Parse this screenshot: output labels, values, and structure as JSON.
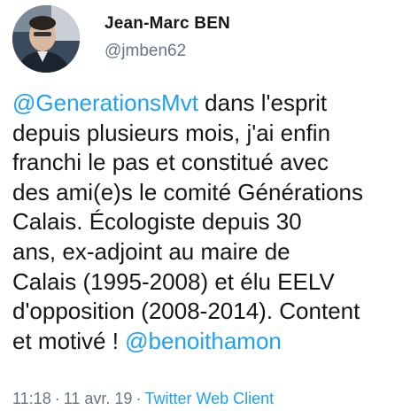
{
  "author": {
    "name": "Jean-Marc BEN",
    "handle": "@jmben62"
  },
  "tweet": {
    "lines": [
      {
        "mention": "@GenerationsMvt",
        "text": " dans l'esprit"
      },
      {
        "text": "depuis plusieurs mois, j'ai enfin"
      },
      {
        "text": "franchi le pas et constitué avec"
      },
      {
        "text": "des ami(e)s le comité Générations"
      },
      {
        "text": "Calais. Écologiste depuis 30"
      },
      {
        "text": "ans, ex-adjoint au maire de"
      },
      {
        "text": "Calais (1995-2008) et élu EELV"
      },
      {
        "text": "d'opposition (2008-2014). Content"
      },
      {
        "text": "et motivé ! ",
        "mention": "@benoithamon"
      }
    ]
  },
  "meta": {
    "time": "11:18",
    "date": "11 avr. 19",
    "separator": "·",
    "client": "Twitter Web Client"
  },
  "colors": {
    "link": "#1da1f2",
    "text": "#14171a",
    "secondary": "#657786"
  }
}
